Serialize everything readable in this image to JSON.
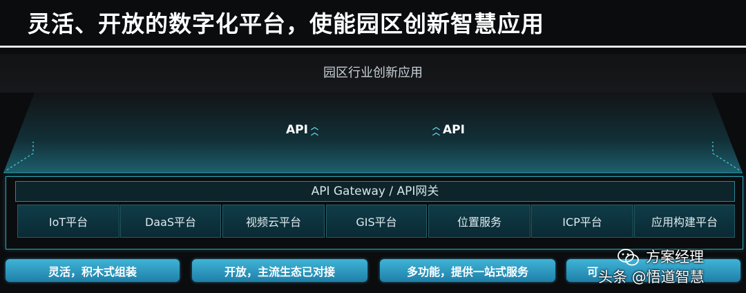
{
  "title": "灵活、开放的数字化平台，使能园区创新智慧应用",
  "top_banner": "园区行业创新应用",
  "api_left": "API",
  "api_right": "API",
  "gateway": "API Gateway / API网关",
  "modules": [
    "IoT平台",
    "DaaS平台",
    "视频云平台",
    "GIS平台",
    "位置服务",
    "ICP平台",
    "应用构建平台"
  ],
  "features": [
    "灵活，积木式组装",
    "开放，主流生态已对接",
    "多功能，提供一站式服务",
    "可"
  ],
  "watermark": {
    "line1": "方案经理",
    "line2": "头条 @悟道智慧"
  },
  "colors": {
    "accent": "#2aa7b6",
    "pill": "#2f9cc8",
    "background": "#0b0c0e"
  }
}
